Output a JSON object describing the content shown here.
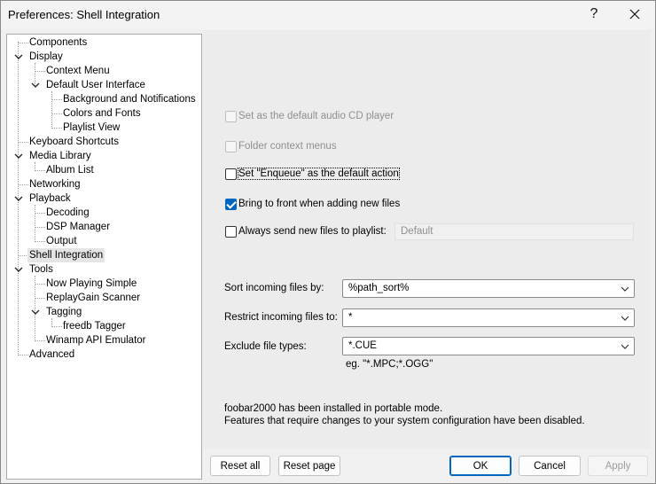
{
  "window": {
    "title": "Preferences: Shell Integration",
    "help_glyph": "?",
    "close_glyph": "✕"
  },
  "tree": {
    "items": [
      {
        "label": "Components"
      },
      {
        "label": "Display"
      },
      {
        "label": "Context Menu"
      },
      {
        "label": "Default User Interface"
      },
      {
        "label": "Background and Notifications"
      },
      {
        "label": "Colors and Fonts"
      },
      {
        "label": "Playlist View"
      },
      {
        "label": "Keyboard Shortcuts"
      },
      {
        "label": "Media Library"
      },
      {
        "label": "Album List"
      },
      {
        "label": "Networking"
      },
      {
        "label": "Playback"
      },
      {
        "label": "Decoding"
      },
      {
        "label": "DSP Manager"
      },
      {
        "label": "Output"
      },
      {
        "label": "Shell Integration"
      },
      {
        "label": "Tools"
      },
      {
        "label": "Now Playing Simple"
      },
      {
        "label": "ReplayGain Scanner"
      },
      {
        "label": "Tagging"
      },
      {
        "label": "freedb Tagger"
      },
      {
        "label": "Winamp API Emulator"
      },
      {
        "label": "Advanced"
      }
    ],
    "selected": "Shell Integration"
  },
  "options": {
    "default_cd_player": {
      "label": "Set as the default audio CD player",
      "checked": false,
      "enabled": false
    },
    "folder_context_menus": {
      "label": "Folder context menus",
      "checked": false,
      "enabled": false
    },
    "enqueue_default": {
      "label": "Set \"Enqueue\" as the default action",
      "checked": false,
      "enabled": true
    },
    "bring_to_front": {
      "label": "Bring to front when adding new files",
      "checked": true,
      "enabled": true
    },
    "always_send": {
      "label": "Always send new files to playlist:",
      "checked": false,
      "enabled": true
    },
    "playlist_value": "Default"
  },
  "fields": {
    "sort_label": "Sort incoming files by:",
    "sort_value": "%path_sort%",
    "restrict_label": "Restrict incoming files to:",
    "restrict_value": "*",
    "exclude_label": "Exclude file types:",
    "exclude_value": "*.CUE",
    "exclude_hint": "eg. \"*.MPC;*.OGG\""
  },
  "notice": {
    "line1": "foobar2000 has been installed in portable mode.",
    "line2": "Features that require changes to your system configuration have been disabled."
  },
  "buttons": {
    "reset_all": "Reset all",
    "reset_page": "Reset page",
    "ok": "OK",
    "cancel": "Cancel",
    "apply": "Apply"
  },
  "colors": {
    "accent": "#0067c0",
    "disabled_text": "#8f8f8f"
  }
}
